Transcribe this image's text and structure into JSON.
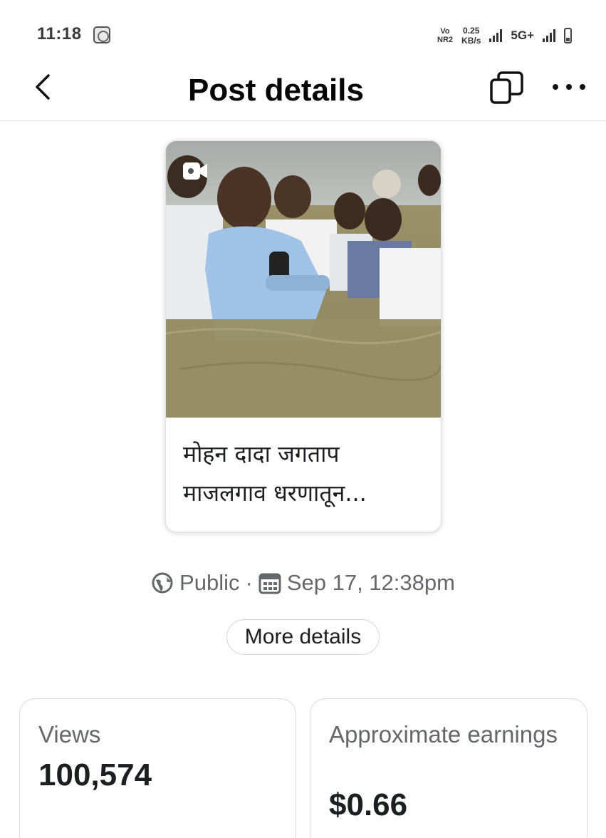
{
  "status_bar": {
    "time": "11:18",
    "vo": "Vo",
    "nr": "NR2",
    "speed_value": "0.25",
    "speed_unit": "KB/s",
    "network": "5G+"
  },
  "header": {
    "title": "Post details"
  },
  "post": {
    "caption_line1": "मोहन दादा जगताप",
    "caption_line2": "माजलगाव धरणातून..."
  },
  "meta": {
    "audience": "Public",
    "separator": "·",
    "date": "Sep 17, 12:38pm"
  },
  "more_details_label": "More details",
  "stats": {
    "views_label": "Views",
    "views_value": "100,574",
    "earnings_label": "Approximate earnings",
    "earnings_value": "$0.66"
  },
  "icons": {
    "back": "chevron-left-icon",
    "copy": "copy-icon",
    "more": "more-horizontal-icon",
    "video": "video-camera-icon",
    "globe": "globe-icon",
    "calendar": "calendar-icon"
  }
}
